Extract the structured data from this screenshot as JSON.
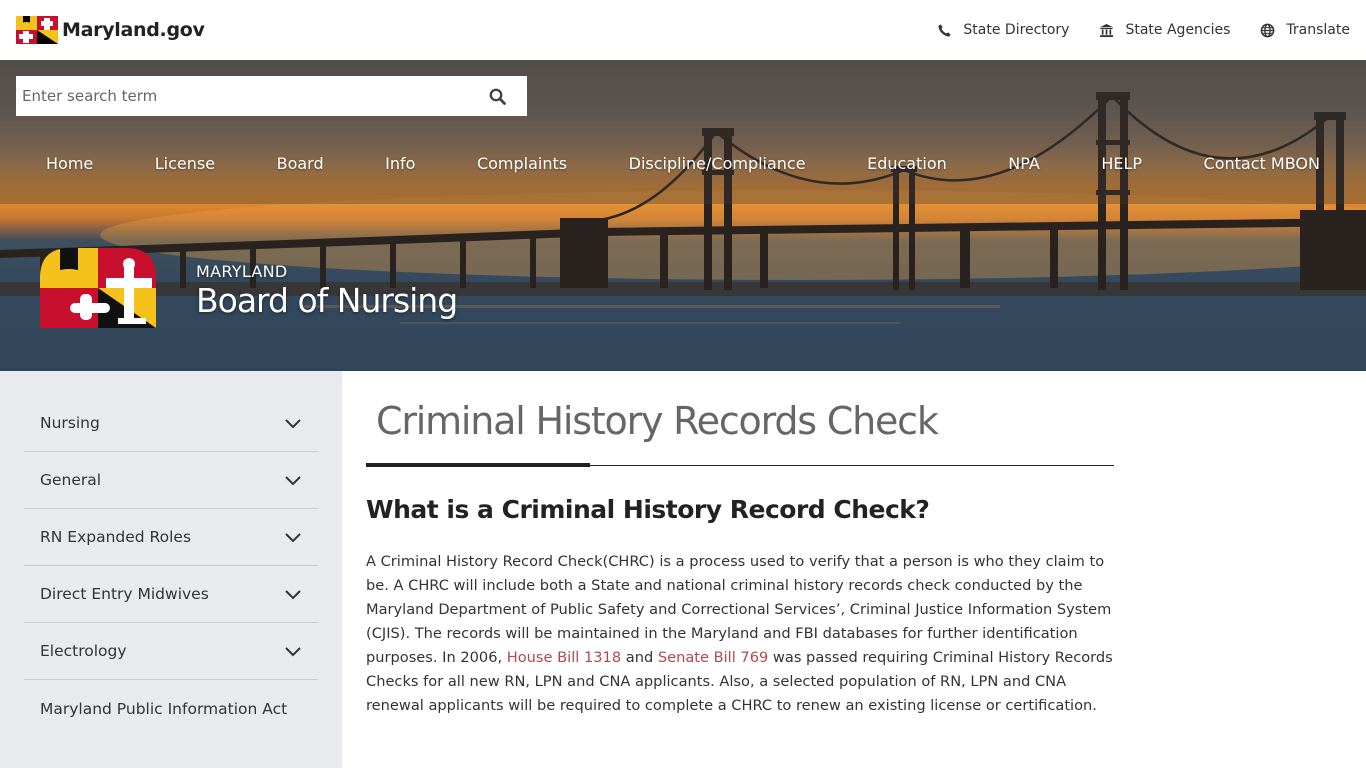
{
  "header": {
    "site_name": "Maryland.gov",
    "util_links": [
      {
        "label": "State Directory",
        "icon": "phone-icon"
      },
      {
        "label": "State Agencies",
        "icon": "building-icon"
      },
      {
        "label": "Translate",
        "icon": "globe-icon"
      }
    ]
  },
  "search": {
    "placeholder": "Enter search term",
    "value": ""
  },
  "nav": [
    "Home",
    "License",
    "Board",
    "Info",
    "Complaints",
    "Discipline/Compliance",
    "Education",
    "NPA",
    "HELP",
    "Contact MBON"
  ],
  "brand": {
    "sub": "MARYLAND",
    "title": "Board of Nursing"
  },
  "sidebar": {
    "items": [
      {
        "label": "Nursing",
        "expandable": true
      },
      {
        "label": "General",
        "expandable": true
      },
      {
        "label": "RN Expanded Roles",
        "expandable": true
      },
      {
        "label": "Direct Entry Midwives",
        "expandable": true
      },
      {
        "label": "Electrology",
        "expandable": true
      },
      {
        "label": "Maryland Public Information Act",
        "expandable": false
      }
    ]
  },
  "main": {
    "title": "Criminal History Records Check",
    "subhead": "What is a Criminal History Record Check?",
    "para_part1": "A Criminal History Record Check(CHRC) is a process used to verify that a person is who they claim to be. A CHRC will include both a State and national criminal history records check conducted by the Maryland Department of Public Safety and Correctional Services’, Criminal Justice Information System (CJIS). The records will be maintained in the Maryland and FBI databases for further identification purposes. In 2006, ",
    "link1": "House Bill 1318",
    "para_part2": " and ",
    "link2": "Senate Bill 769",
    "para_part3": " was passed requiring Criminal History Records Checks for all new RN, LPN and CNA applicants. Also, a selected population of RN, LPN and CNA renewal applicants will be required to complete a CHRC to renew an existing license or certification."
  },
  "colors": {
    "link": "#b5464f",
    "sidebar_bg": "#e8eaed",
    "flag_gold": "#f4c21b",
    "flag_red": "#c8102e"
  }
}
